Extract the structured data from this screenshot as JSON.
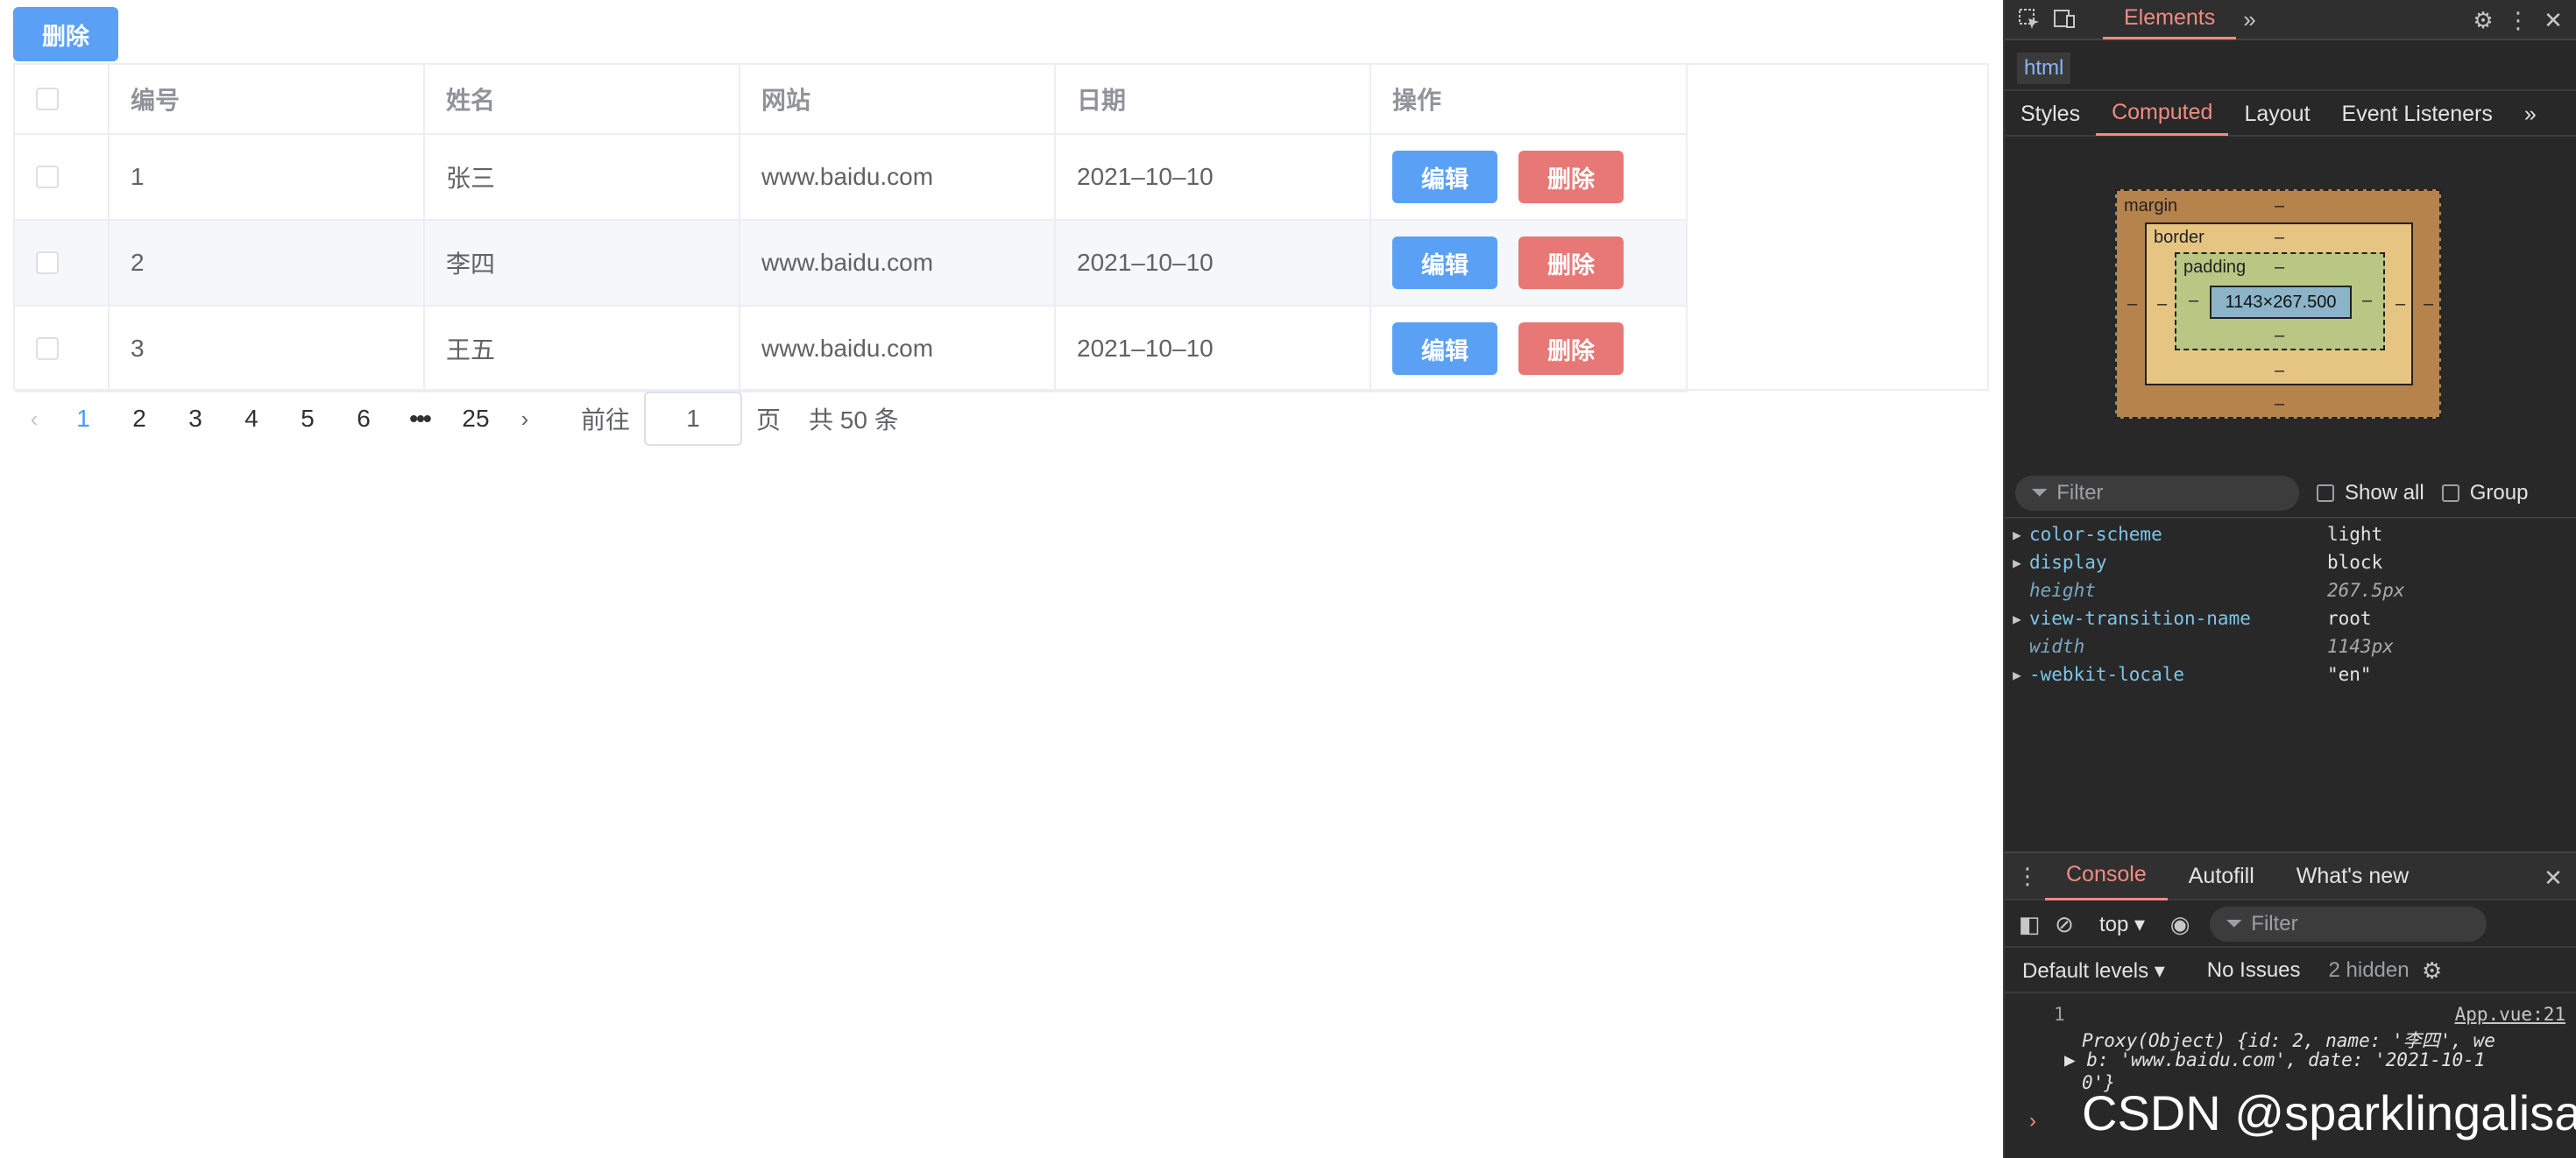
{
  "toolbar": {
    "delete_label": "删除"
  },
  "table": {
    "headers": [
      "编号",
      "姓名",
      "网站",
      "日期",
      "操作"
    ],
    "rows": [
      {
        "id": "1",
        "name": "张三",
        "web": "www.baidu.com",
        "date": "2021–10–10"
      },
      {
        "id": "2",
        "name": "李四",
        "web": "www.baidu.com",
        "date": "2021–10–10"
      },
      {
        "id": "3",
        "name": "王五",
        "web": "www.baidu.com",
        "date": "2021–10–10"
      }
    ],
    "edit_label": "编辑",
    "delete_label": "删除"
  },
  "pagination": {
    "pages": [
      "1",
      "2",
      "3",
      "4",
      "5",
      "6"
    ],
    "more": "•••",
    "last": "25",
    "active": "1",
    "goto_label": "前往",
    "goto_value": "1",
    "page_unit": "页",
    "total": "共 50 条"
  },
  "devtools": {
    "tab_elements": "Elements",
    "breadcrumb": "html",
    "subtabs": [
      "Styles",
      "Computed",
      "Layout",
      "Event Listeners"
    ],
    "box_model": {
      "margin_label": "margin",
      "border_label": "border",
      "padding_label": "padding",
      "content": "1143×267.500",
      "dash": "–"
    },
    "filter_placeholder": "Filter",
    "show_all": "Show all",
    "group": "Group",
    "props": [
      {
        "name": "color-scheme",
        "value": "light"
      },
      {
        "name": "display",
        "value": "block"
      },
      {
        "name": "height",
        "value": "267.5px"
      },
      {
        "name": "view-transition-name",
        "value": "root"
      },
      {
        "name": "width",
        "value": "1143px"
      },
      {
        "name": "-webkit-locale",
        "value": "\"en\""
      }
    ],
    "console_tabs": [
      "Console",
      "Autofill",
      "What's new"
    ],
    "context": "top",
    "console_filter": "Filter",
    "levels": "Default levels",
    "issues": "No Issues",
    "hidden": "2 hidden",
    "log_num": "1",
    "log_src": "App.vue:21",
    "log_lines": [
      "Proxy(Object) {id: 2, name: '李四', we",
      "b: 'www.baidu.com', date: '2021-10-1",
      "0'}"
    ]
  },
  "watermark": "CSDN @sparklingalisa"
}
